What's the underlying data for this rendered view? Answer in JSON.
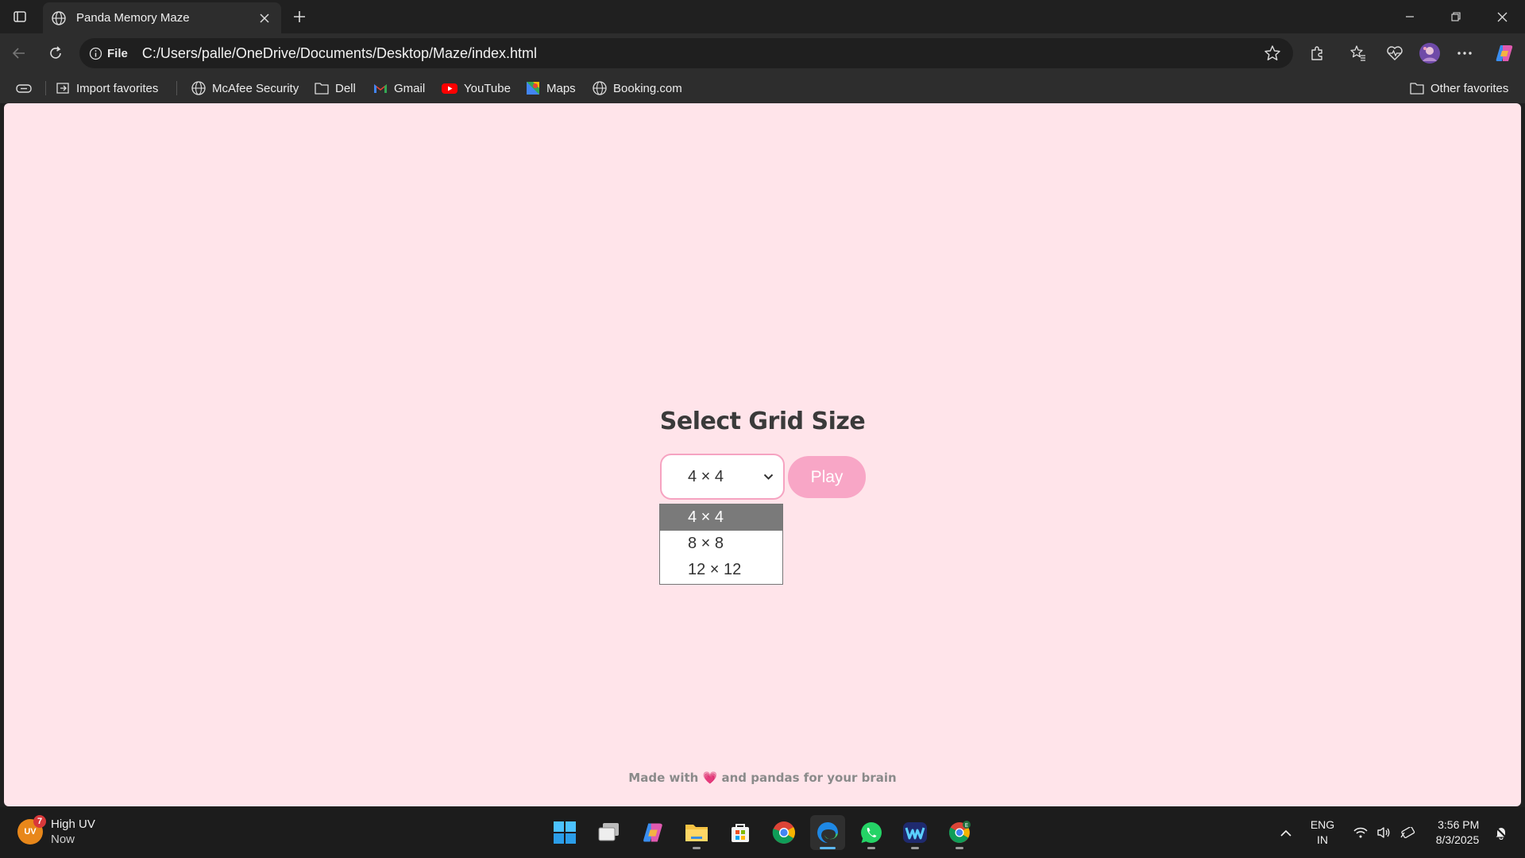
{
  "browser": {
    "tab": {
      "title": "Panda Memory Maze"
    },
    "address": {
      "site_label": "File",
      "url": "C:/Users/palle/OneDrive/Documents/Desktop/Maze/index.html"
    },
    "favorites": {
      "import": "Import favorites",
      "mcafee": "McAfee Security",
      "dell": "Dell",
      "gmail": "Gmail",
      "youtube": "YouTube",
      "maps": "Maps",
      "booking": "Booking.com",
      "other": "Other favorites"
    }
  },
  "page": {
    "heading": "Select Grid Size",
    "select": {
      "value": "4 × 4",
      "options": [
        "4 × 4",
        "8 × 8",
        "12 × 12"
      ],
      "highlighted": "4 × 4"
    },
    "play_label": "Play",
    "footer": {
      "before": "Made with",
      "heart": "💗",
      "after": "and pandas for your brain"
    }
  },
  "taskbar": {
    "weather": {
      "badge": "UV",
      "count": "7",
      "title": "High UV",
      "subtitle": "Now"
    },
    "lang": {
      "line1": "ENG",
      "line2": "IN"
    },
    "clock": {
      "time": "3:56 PM",
      "date": "8/3/2025"
    }
  },
  "colors": {
    "page_background": "#ffe4ea",
    "select_border": "#f6a3c1",
    "play_button": "#f8a6c6",
    "option_highlight": "#7a7a7a"
  }
}
